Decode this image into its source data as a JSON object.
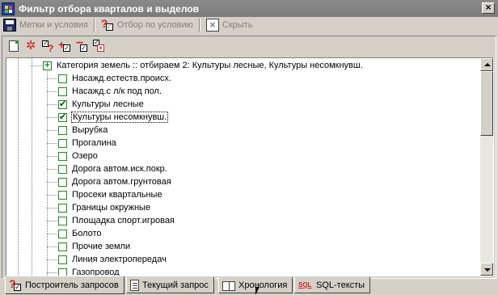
{
  "window": {
    "title": "Фильтр отбора кварталов и выделов",
    "close_glyph": "×"
  },
  "toolbar": {
    "buttons": [
      {
        "label": "Метки и условия",
        "icon": "save-icon"
      },
      {
        "label": "Отбор по условию",
        "icon": "query-check-icon"
      },
      {
        "label": "Скрыть",
        "icon": "close-x-icon"
      }
    ]
  },
  "mini_toolbar": {
    "icons": [
      "new-document-icon",
      "clear-star-icon",
      "check-query-icon",
      "add-check-icon",
      "remove-check-icon",
      "check-list-icon"
    ]
  },
  "tree": {
    "root": {
      "label": "Категория земель :: отбираем 2: Культуры лесные, Культуры несомкнувш.",
      "expander": "+"
    },
    "items": [
      {
        "label": "Насажд.естеств.происх.",
        "checked": false
      },
      {
        "label": "Насажд.с л/к под пол.",
        "checked": false
      },
      {
        "label": "Культуры лесные",
        "checked": true
      },
      {
        "label": "Культуры несомкнувш.",
        "checked": true,
        "focused": true
      },
      {
        "label": "Вырубка",
        "checked": false
      },
      {
        "label": "Прогалина",
        "checked": false
      },
      {
        "label": "Озеро",
        "checked": false
      },
      {
        "label": "Дорога автом.иск.покр.",
        "checked": false
      },
      {
        "label": "Дорога автом.грунтовая",
        "checked": false
      },
      {
        "label": "Просеки квартальные",
        "checked": false
      },
      {
        "label": "Границы окружные",
        "checked": false
      },
      {
        "label": "Площадка спорт.игровая",
        "checked": false
      },
      {
        "label": "Болото",
        "checked": false
      },
      {
        "label": "Прочие земли",
        "checked": false
      },
      {
        "label": "Линия электропередач",
        "checked": false
      },
      {
        "label": "Газопровод",
        "checked": false
      }
    ],
    "check_glyph": "✔"
  },
  "tabs": [
    {
      "label": "Построитель запросов",
      "icon": "query-builder-icon",
      "active": true
    },
    {
      "label": "Текущий запрос",
      "icon": "document-icon",
      "active": false
    },
    {
      "label": "Хронология",
      "icon": "book-icon",
      "active": false
    },
    {
      "label": "SQL-тексты",
      "icon": "sql-icon",
      "icon_text": "SQL",
      "active": false
    }
  ]
}
